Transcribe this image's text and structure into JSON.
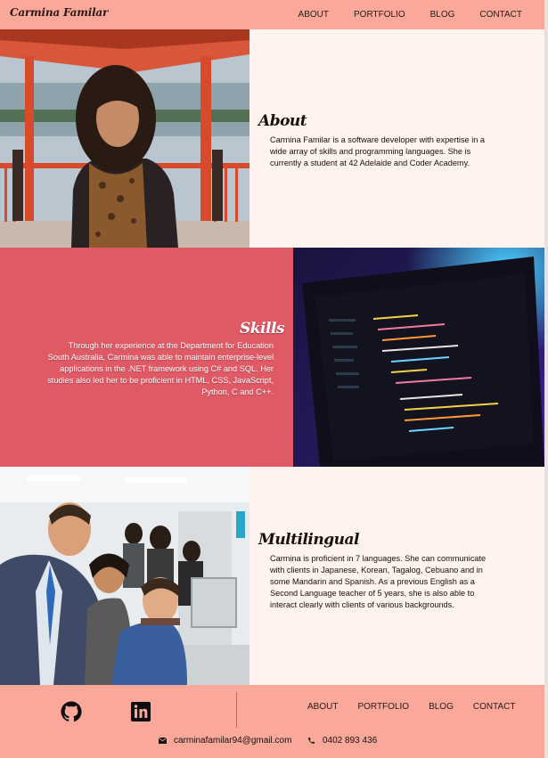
{
  "nav": {
    "brand": "Carmina Familar",
    "links": [
      "ABOUT",
      "PORTFOLIO",
      "BLOG",
      "CONTACT"
    ]
  },
  "about": {
    "heading": "About",
    "text": "Carmina Familar is a software developer with expertise in a wide array of skills and programming languages. She is currently a student at 42 Adelaide and Coder Academy."
  },
  "skills": {
    "heading": "Skills",
    "text": "Through her experience at the Department for Education South Australia, Carmina was able to maintain enterprise-level applications in the .NET framework using C# and SQL. Her studies also led her to be proficient in HTML, CSS, JavaScript, Python, C and C++."
  },
  "multilingual": {
    "heading": "Multilingual",
    "text": "Carmina is proficient in 7 languages. She can communicate with clients in Japanese, Korean, Tagalog, Cebuano and in some Mandarin and Spanish. As a previous English as a Second Language teacher of 5 years, she is also able to interact clearly with clients of various backgrounds."
  },
  "footer": {
    "social": [
      "github-icon",
      "linkedin-icon"
    ],
    "links": [
      "ABOUT",
      "PORTFOLIO",
      "BLOG",
      "CONTACT"
    ],
    "email": "carminafamilar94@gmail.com",
    "phone": "0402 893 436"
  },
  "colors": {
    "nav_bg": "#f9a89a",
    "page_bg": "#fff3ef",
    "skills_bg": "#e05a66",
    "text": "#1a0f0d"
  }
}
